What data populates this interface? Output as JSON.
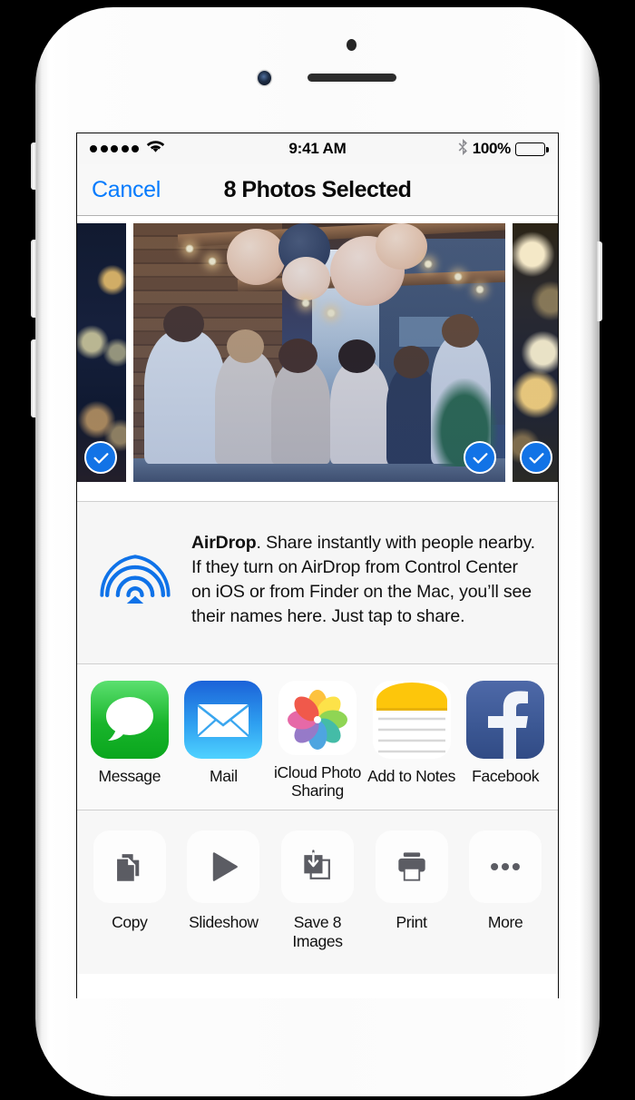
{
  "device": {
    "name": "iPhone",
    "body_color": "#fbfbfb",
    "camera": "front-camera",
    "speaker": "earpiece-speaker"
  },
  "status_bar": {
    "signal_dots": 5,
    "wifi": "wifi-icon",
    "time": "9:41 AM",
    "bluetooth": "bluetooth-icon",
    "battery_percent": "100%",
    "battery_level": 100
  },
  "nav_bar": {
    "cancel_label": "Cancel",
    "title": "8 Photos Selected",
    "accent_color": "#067bfd"
  },
  "photos": {
    "selection_count": 8,
    "badge_color": "#1273e6",
    "tiles": [
      {
        "id": "photo-partial-left",
        "selected": true,
        "description": "night bokeh lights"
      },
      {
        "id": "photo-main",
        "selected": true,
        "description": "friends at rooftop party with paper lanterns"
      },
      {
        "id": "photo-partial-right",
        "selected": true,
        "description": "warm string lights with star ornament"
      }
    ]
  },
  "airdrop": {
    "icon": "airdrop-icon",
    "title": "AirDrop",
    "body": ". Share instantly with people nearby. If they turn on AirDrop from Control Center on iOS or from Finder on the Mac, you’ll see their names here. Just tap to share.",
    "color": "#0f72e8"
  },
  "share_apps": [
    {
      "icon": "message-icon",
      "label": "Message",
      "color": "#19b52c"
    },
    {
      "icon": "mail-icon",
      "label": "Mail",
      "color": "#2e9ff0"
    },
    {
      "icon": "icloud-photo-sharing-icon",
      "label": "iCloud Photo\nSharing",
      "color": "#ffffff"
    },
    {
      "icon": "notes-icon",
      "label": "Add to Notes",
      "color": "#ffcc00"
    },
    {
      "icon": "facebook-icon",
      "label": "Facebook",
      "color": "#3b5793"
    }
  ],
  "actions": [
    {
      "icon": "copy-icon",
      "label": "Copy"
    },
    {
      "icon": "play-icon",
      "label": "Slideshow"
    },
    {
      "icon": "save-icon",
      "label": "Save 8\nImages"
    },
    {
      "icon": "printer-icon",
      "label": "Print"
    },
    {
      "icon": "ellipsis-icon",
      "label": "More"
    }
  ]
}
